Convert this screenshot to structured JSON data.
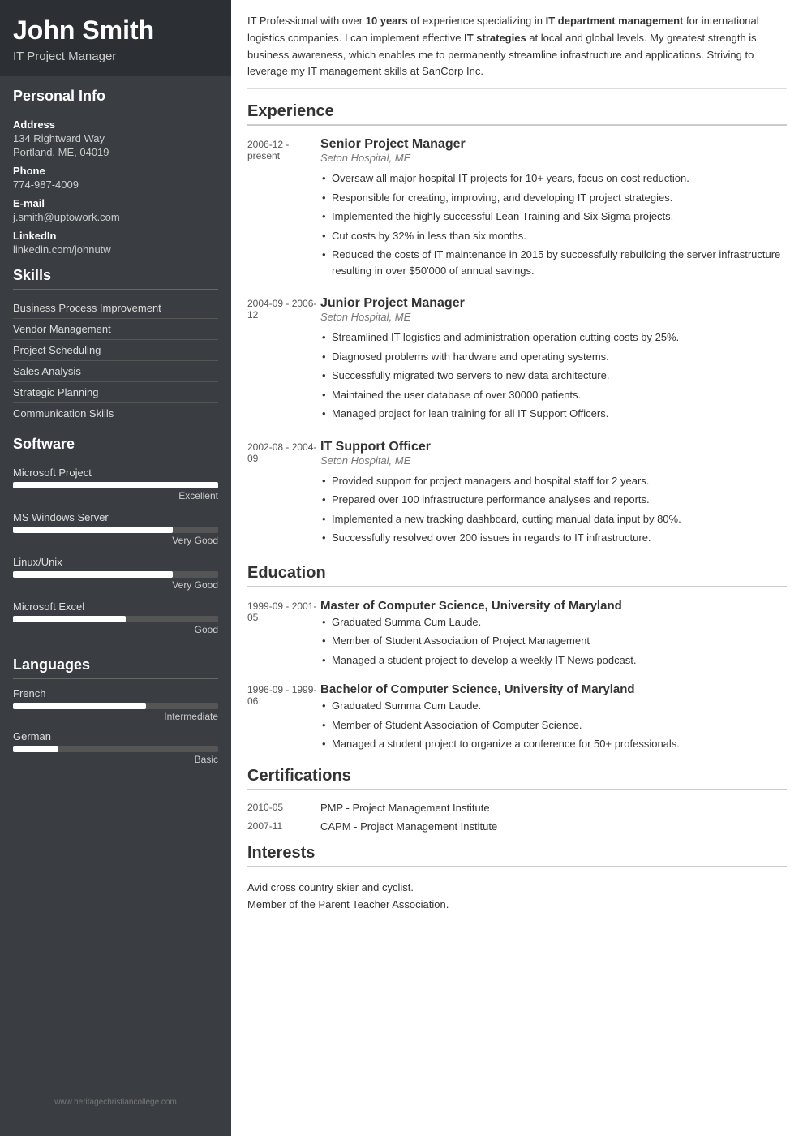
{
  "sidebar": {
    "name": "John Smith",
    "title": "IT Project Manager",
    "personal_info": {
      "label": "Personal Info",
      "address_label": "Address",
      "address_line1": "134 Rightward Way",
      "address_line2": "Portland, ME, 04019",
      "phone_label": "Phone",
      "phone": "774-987-4009",
      "email_label": "E-mail",
      "email": "j.smith@uptowork.com",
      "linkedin_label": "LinkedIn",
      "linkedin": "linkedin.com/johnutw"
    },
    "skills": {
      "label": "Skills",
      "items": [
        "Business Process Improvement",
        "Vendor Management",
        "Project Scheduling",
        "Sales Analysis",
        "Strategic Planning",
        "Communication Skills"
      ]
    },
    "software": {
      "label": "Software",
      "items": [
        {
          "name": "Microsoft Project",
          "percent": 100,
          "level": "Excellent"
        },
        {
          "name": "MS Windows Server",
          "percent": 78,
          "level": "Very Good"
        },
        {
          "name": "Linux/Unix",
          "percent": 78,
          "level": "Very Good"
        },
        {
          "name": "Microsoft Excel",
          "percent": 55,
          "level": "Good"
        }
      ]
    },
    "languages": {
      "label": "Languages",
      "items": [
        {
          "name": "French",
          "percent": 65,
          "level": "Intermediate"
        },
        {
          "name": "German",
          "percent": 22,
          "level": "Basic"
        }
      ]
    },
    "watermark": "www.heritagechristiancollege.com"
  },
  "main": {
    "summary": "IT Professional with over 10 years of experience specializing in IT department management for international logistics companies. I can implement effective IT strategies at local and global levels. My greatest strength is business awareness, which enables me to permanently streamline infrastructure and applications. Striving to leverage my IT management skills at SanCorp Inc.",
    "experience": {
      "label": "Experience",
      "items": [
        {
          "date": "2006-12 - present",
          "title": "Senior Project Manager",
          "company": "Seton Hospital, ME",
          "bullets": [
            "Oversaw all major hospital IT projects for 10+ years, focus on cost reduction.",
            "Responsible for creating, improving, and developing IT project strategies.",
            "Implemented the highly successful Lean Training and Six Sigma projects.",
            "Cut costs by 32% in less than six months.",
            "Reduced the costs of IT maintenance in 2015 by successfully rebuilding the server infrastructure resulting in over $50'000 of annual savings."
          ]
        },
        {
          "date": "2004-09 - 2006-12",
          "title": "Junior Project Manager",
          "company": "Seton Hospital, ME",
          "bullets": [
            "Streamlined IT logistics and administration operation cutting costs by 25%.",
            "Diagnosed problems with hardware and operating systems.",
            "Successfully migrated two servers to new data architecture.",
            "Maintained the user database of over 30000 patients.",
            "Managed project for lean training for all IT Support Officers."
          ]
        },
        {
          "date": "2002-08 - 2004-09",
          "title": "IT Support Officer",
          "company": "Seton Hospital, ME",
          "bullets": [
            "Provided support for project managers and hospital staff for 2 years.",
            "Prepared over 100 infrastructure performance analyses and reports.",
            "Implemented a new tracking dashboard, cutting manual data input by 80%.",
            "Successfully resolved over 200 issues in regards to IT infrastructure."
          ]
        }
      ]
    },
    "education": {
      "label": "Education",
      "items": [
        {
          "date": "1999-09 - 2001-05",
          "title": "Master of Computer Science, University of Maryland",
          "bullets": [
            "Graduated Summa Cum Laude.",
            "Member of Student Association of Project Management",
            "Managed a student project to develop a weekly IT News podcast."
          ]
        },
        {
          "date": "1996-09 - 1999-06",
          "title": "Bachelor of Computer Science, University of Maryland",
          "bullets": [
            "Graduated Summa Cum Laude.",
            "Member of Student Association of Computer Science.",
            "Managed a student project to organize a conference for 50+ professionals."
          ]
        }
      ]
    },
    "certifications": {
      "label": "Certifications",
      "items": [
        {
          "date": "2010-05",
          "name": "PMP - Project Management Institute"
        },
        {
          "date": "2007-11",
          "name": "CAPM - Project Management Institute"
        }
      ]
    },
    "interests": {
      "label": "Interests",
      "items": [
        "Avid cross country skier and cyclist.",
        "Member of the Parent Teacher Association."
      ]
    }
  }
}
